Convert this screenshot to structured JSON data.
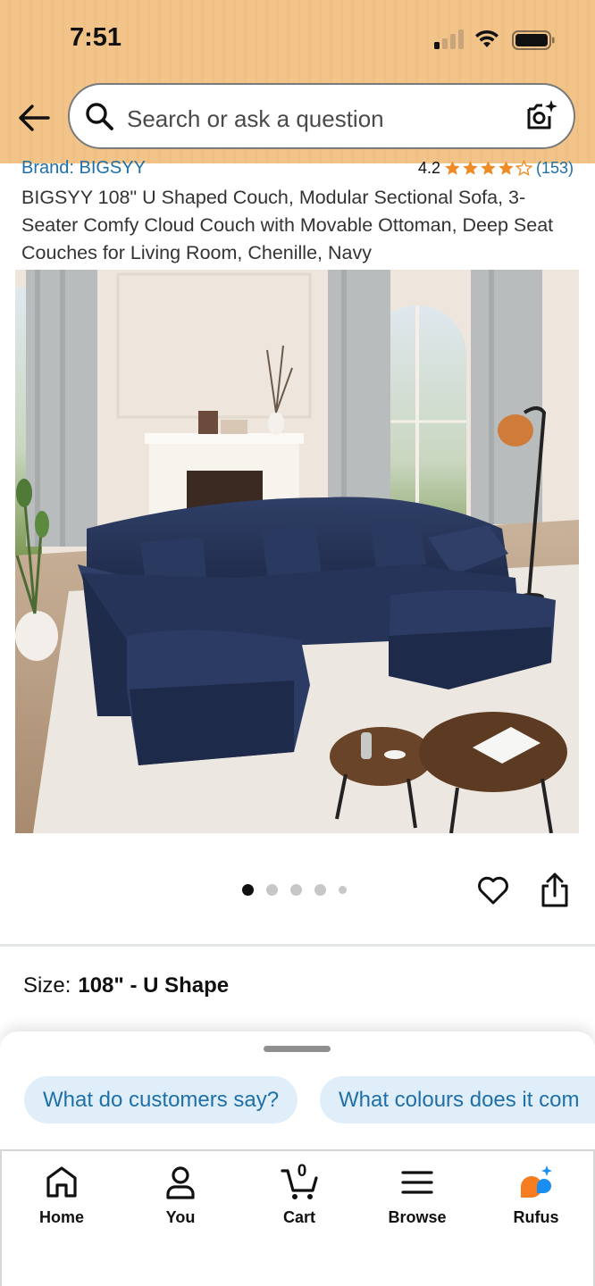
{
  "status_bar": {
    "time": "7:51"
  },
  "search": {
    "placeholder": "Search or ask a question"
  },
  "product": {
    "brand": "Brand: BIGSYY",
    "rating": "4.2",
    "rating_stars": 4.2,
    "review_count": "(153)",
    "title": "BIGSYY 108\" U Shaped Couch, Modular Sectional Sofa, 3-Seater Comfy Cloud Couch with Movable Ottoman, Deep Seat Couches for Living Room, Chenille, Navy",
    "image_count": 5,
    "active_image_index": 0
  },
  "size": {
    "label": "Size:",
    "value": "108\" - U Shape"
  },
  "rufus_chips": [
    {
      "label": "What do customers say?"
    },
    {
      "label": "What colours does it com"
    }
  ],
  "tabbar": {
    "items": [
      {
        "label": "Home",
        "icon": "home-icon"
      },
      {
        "label": "You",
        "icon": "person-icon"
      },
      {
        "label": "Cart",
        "icon": "cart-icon",
        "count": "0"
      },
      {
        "label": "Browse",
        "icon": "menu-icon"
      },
      {
        "label": "Rufus",
        "icon": "rufus-icon"
      }
    ]
  },
  "colors": {
    "header": "#f2c48a",
    "link": "#1f6fa8",
    "star": "#f08a24",
    "chip_bg": "#e0eef9",
    "rufus_orange": "#f57c1f",
    "rufus_blue": "#1a8ff0"
  }
}
